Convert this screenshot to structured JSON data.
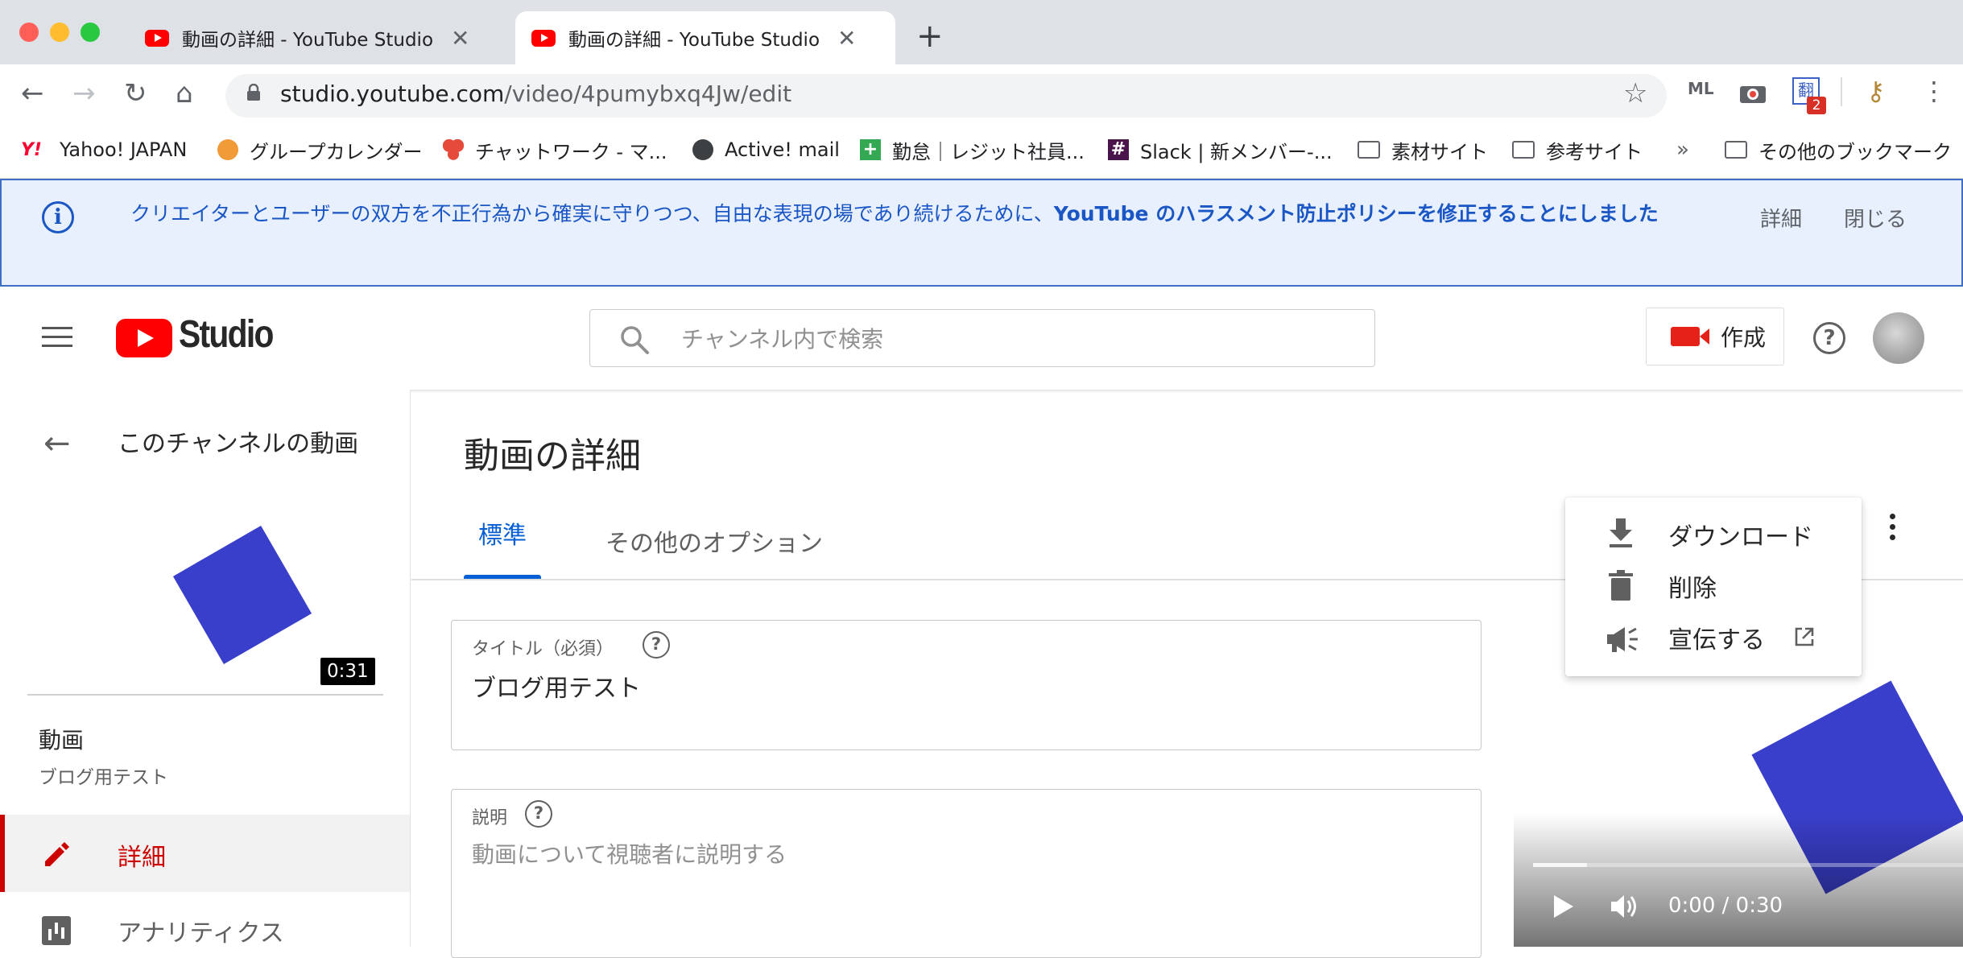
{
  "browser": {
    "tabs": [
      {
        "title": "動画の詳細 - YouTube Studio",
        "close": "✕"
      },
      {
        "title": "動画の詳細 - YouTube Studio",
        "close": "✕"
      }
    ],
    "new_tab": "+",
    "url_host": "studio.youtube.com",
    "url_path": "/video/4pumybxq4Jw/edit",
    "extension_badge": "2",
    "bookmarks": [
      "Yahoo! JAPAN",
      "グループカレンダー",
      "チャットワーク - マ...",
      "Active! mail",
      "勤怠｜レジット社員...",
      "Slack | 新メンバー-...",
      "素材サイト",
      "参考サイト"
    ],
    "bookmarks_overflow": "»",
    "other_bookmarks": "その他のブックマーク"
  },
  "banner": {
    "text_before": "クリエイターとユーザーの双方を不正行為から確実に守りつつ、自由な表現の場であり続けるために、",
    "link": "YouTube のハラスメント防止ポリシーを修正することにしました",
    "detail": "詳細",
    "close": "閉じる"
  },
  "header": {
    "logo_text": "Studio",
    "search_placeholder": "チャンネル内で検索",
    "create_label": "作成",
    "help": "?"
  },
  "sidebar": {
    "back_label": "このチャンネルの動画",
    "thumbnail_duration": "0:31",
    "video_label": "動画",
    "video_title": "ブログ用テスト",
    "items": [
      {
        "label": "詳細",
        "active": true
      },
      {
        "label": "アナリティクス",
        "active": false
      }
    ]
  },
  "main": {
    "page_title": "動画の詳細",
    "tabs": [
      {
        "label": "標準",
        "active": true
      },
      {
        "label": "その他のオプション",
        "active": false
      }
    ],
    "title_field": {
      "label": "タイトル（必須）",
      "value": "ブログ用テスト"
    },
    "description_field": {
      "label": "説明",
      "placeholder": "動画について視聴者に説明する"
    }
  },
  "menu": {
    "items": [
      {
        "label": "ダウンロード",
        "icon": "download-icon"
      },
      {
        "label": "削除",
        "icon": "trash-icon"
      },
      {
        "label": "宣伝する",
        "icon": "megaphone-icon"
      }
    ]
  },
  "player": {
    "time": "0:00 / 0:30",
    "progress": 0.125
  },
  "colors": {
    "accent_blue": "#065fd4",
    "active_red": "#cc0000",
    "youtube_red": "#ff0000",
    "banner_bg": "#e8f0fe"
  }
}
